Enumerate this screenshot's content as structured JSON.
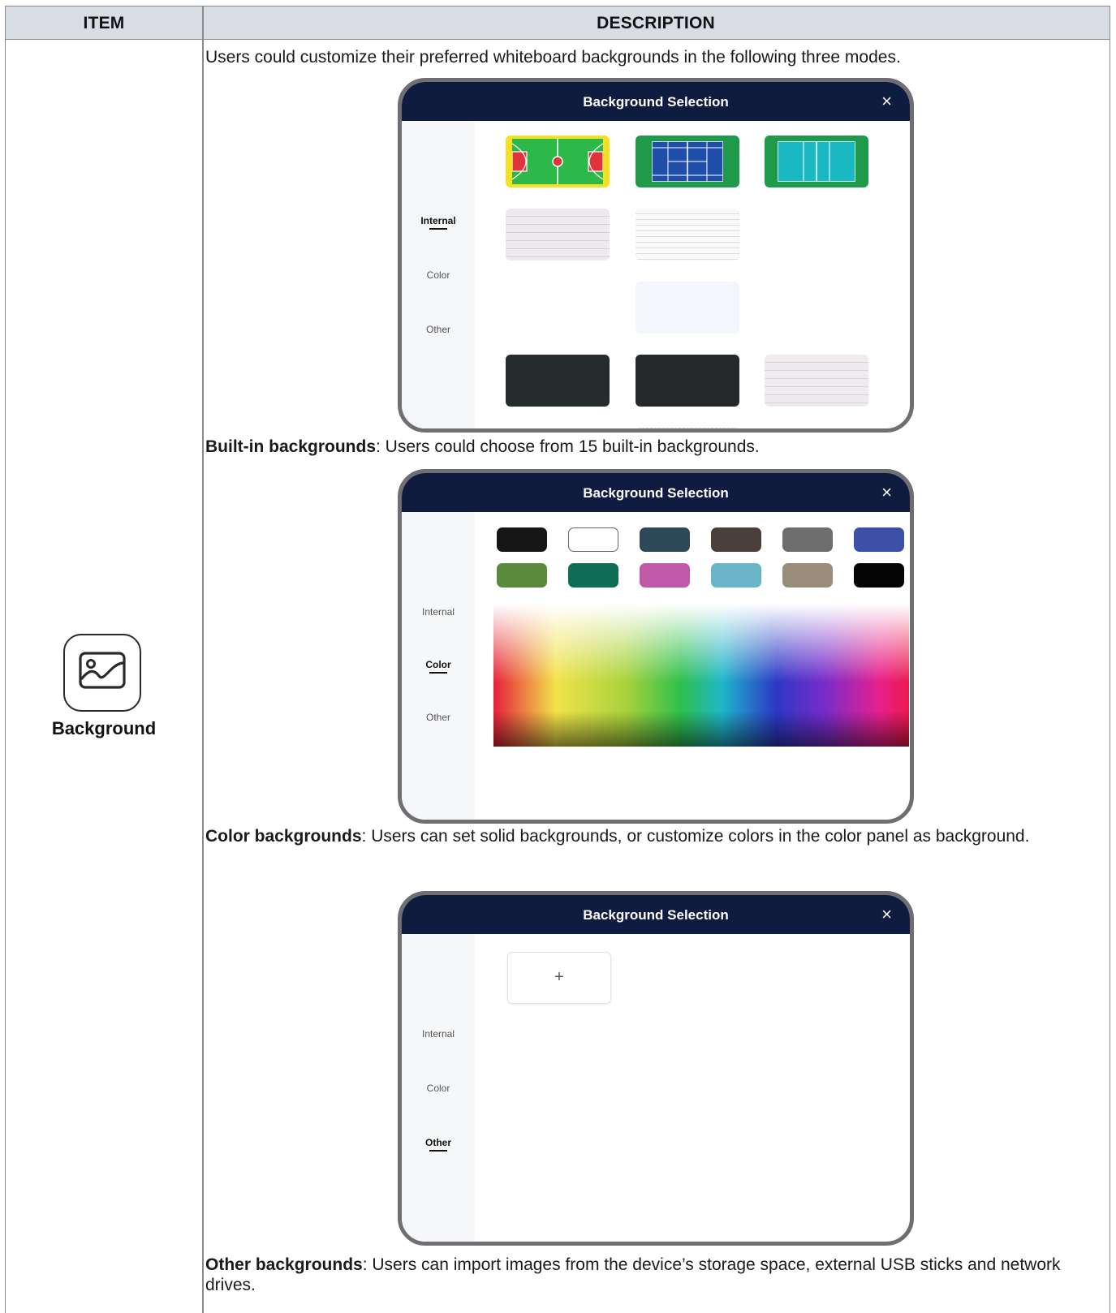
{
  "table": {
    "header_item": "ITEM",
    "header_description": "DESCRIPTION"
  },
  "item": {
    "icon": "image-icon",
    "label": "Background"
  },
  "intro": "Users could customize their preferred whiteboard backgrounds in the following three modes.",
  "dialog": {
    "title": "Background Selection",
    "close_glyph": "×",
    "tabs": [
      "Internal",
      "Color",
      "Other"
    ]
  },
  "builtin": {
    "term": "Built-in backgrounds",
    "text": ": Users could choose from 15 built-in backgrounds."
  },
  "color": {
    "term": "Color backgrounds",
    "text": ": Users can set solid backgrounds, or customize colors in the color panel as background.",
    "swatches": [
      "#161616",
      "#ffffff",
      "#2e4a5a",
      "#4a3f3a",
      "#6e6e6e",
      "#3d4fa8",
      "#5a8a3c",
      "#0d6e55",
      "#c05aa8",
      "#6ab4c8",
      "#9a8c7a",
      "#050505"
    ]
  },
  "other": {
    "term": "Other backgrounds",
    "text": ": Users can import images from the device’s storage space, external USB sticks and network drives.",
    "upload_glyph": "+"
  }
}
